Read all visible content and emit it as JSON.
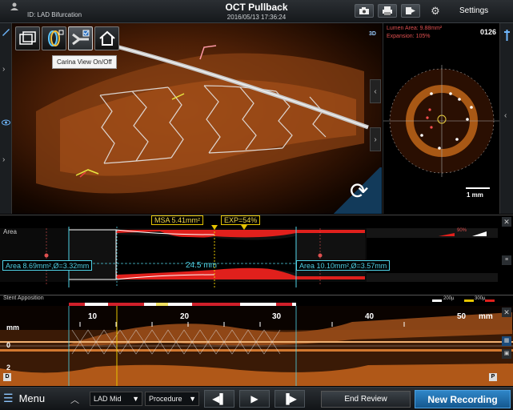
{
  "header": {
    "patient_id": "ID: LAD Bifurcation",
    "title": "OCT Pullback",
    "datetime": "2016/05/13 17:36:24",
    "settings_label": "Settings"
  },
  "view3d": {
    "tooltip": "Carina View On/Off",
    "label_3d": "3D",
    "toolbar": [
      "frames-view",
      "rings-view",
      "carina-view",
      "home-view"
    ]
  },
  "cross_section": {
    "lumen_area": "Lumen Area: 9.88mm²",
    "expansion": "Expansion: 105%",
    "frame_number": "0126",
    "scale_label": "1 mm"
  },
  "profile": {
    "area_label": "Area",
    "msa": "MSA 5.41mm²",
    "exp": "EXP=54%",
    "pct": "90%",
    "proximal_ref": "Area 8.69mm²,Ø=3.32mm",
    "length": "24.5 mm",
    "distal_ref": "Area 10.10mm²,Ø=3.57mm"
  },
  "stent_apposition": {
    "label": "Stent Apposition",
    "legend": [
      "200µ",
      "300µ"
    ]
  },
  "lmode": {
    "ticks": [
      "10",
      "20",
      "30",
      "40",
      "50"
    ],
    "unit": "mm",
    "axis_unit": "mm",
    "axis_zero": "0",
    "axis_two": "2",
    "left_marker": "D",
    "right_marker": "P"
  },
  "bottom": {
    "menu_label": "Menu",
    "segment": "LAD Mid",
    "procedure": "Procedure",
    "end_review": "End Review",
    "new_recording": "New Recording"
  },
  "colors": {
    "accent_blue": "#2f86c8",
    "measure_cyan": "#4fd2e6",
    "badge_yellow": "#e6c400",
    "profile_red": "#e0201c"
  }
}
